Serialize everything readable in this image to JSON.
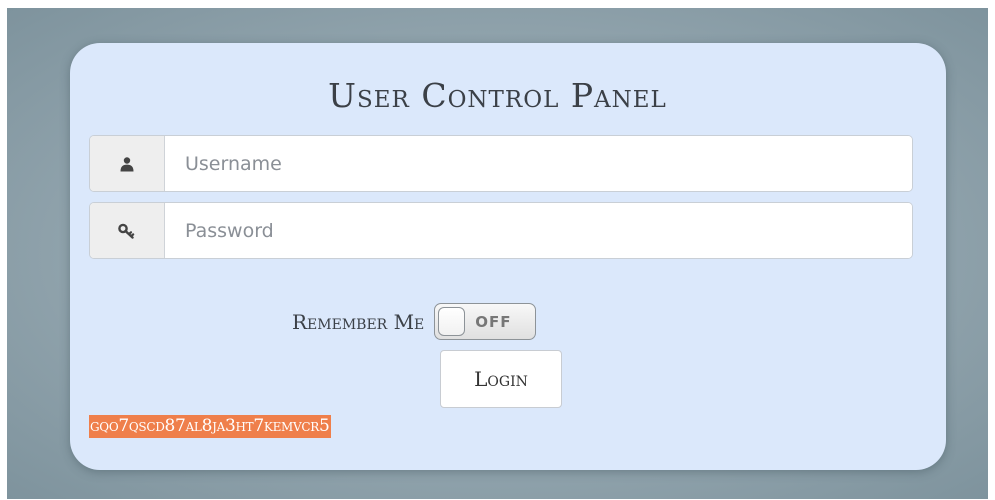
{
  "panel": {
    "title": "User Control Panel"
  },
  "username": {
    "icon": "user-icon",
    "placeholder": "Username",
    "value": ""
  },
  "password": {
    "icon": "key-icon",
    "placeholder": "Password",
    "value": ""
  },
  "remember": {
    "label": "Remember Me",
    "toggle_state": "OFF"
  },
  "login": {
    "label": "Login"
  },
  "token": {
    "text": "gqo7qscd87al8ja3ht7kemvcr5"
  },
  "colors": {
    "panel_bg": "#dbe8fb",
    "token_bg": "#ef7f4b"
  }
}
